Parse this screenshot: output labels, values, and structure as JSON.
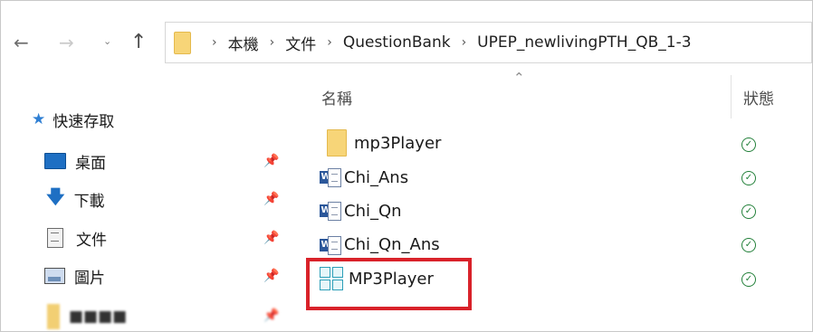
{
  "nav": {
    "back_icon": "←",
    "forward_icon": "→",
    "recent_icon": "⌄",
    "up_icon": "↑"
  },
  "address": {
    "separator": "›",
    "crumbs": [
      "本機",
      "文件",
      "QuestionBank",
      "UPEP_newlivingPTH_QB_1-3"
    ]
  },
  "sidebar": {
    "quick_access": "快速存取",
    "items": [
      {
        "label": "桌面",
        "icon": "desktop-icon",
        "pinned": true
      },
      {
        "label": "下載",
        "icon": "download-icon",
        "pinned": true
      },
      {
        "label": "文件",
        "icon": "documents-icon",
        "pinned": true
      },
      {
        "label": "圖片",
        "icon": "pictures-icon",
        "pinned": true
      },
      {
        "label": "■■■■",
        "icon": "folder-icon",
        "pinned": true
      }
    ],
    "pin_glyph": "📌"
  },
  "columns": {
    "name": "名稱",
    "status": "狀態",
    "sort_glyph": "⌃"
  },
  "files": [
    {
      "name": "mp3Player",
      "type": "folder",
      "status": "available"
    },
    {
      "name": "Chi_Ans",
      "type": "word-document",
      "status": "available"
    },
    {
      "name": "Chi_Qn",
      "type": "word-document",
      "status": "available"
    },
    {
      "name": "Chi_Qn_Ans",
      "type": "word-document",
      "status": "available"
    },
    {
      "name": "MP3Player",
      "type": "application",
      "status": "available"
    }
  ],
  "status_glyph": "✓",
  "colors": {
    "highlight": "#d9222a",
    "status_ok": "#23803a",
    "folder": "#f7d578"
  }
}
